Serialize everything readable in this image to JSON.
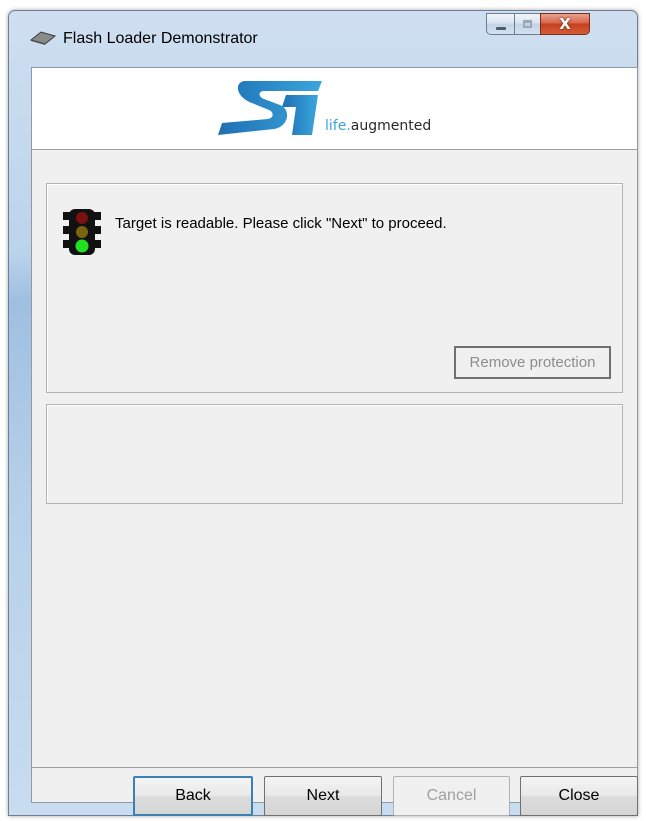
{
  "window": {
    "title": "Flash Loader Demonstrator",
    "controls": {
      "minimize_icon": "minimize-icon",
      "maximize_icon": "maximize-icon",
      "close_glyph": "X"
    }
  },
  "banner": {
    "logo_icon": "st-logo-icon",
    "tagline_prefix": "life.",
    "tagline_suffix": "augmented",
    "brand_color": "#3aa6dc"
  },
  "status": {
    "icon": "traffic-light-icon",
    "message": "Target is readable. Please click \"Next\" to proceed.",
    "remove_protection_label": "Remove protection"
  },
  "buttons": {
    "back": "Back",
    "next": "Next",
    "cancel": "Cancel",
    "close": "Close"
  }
}
